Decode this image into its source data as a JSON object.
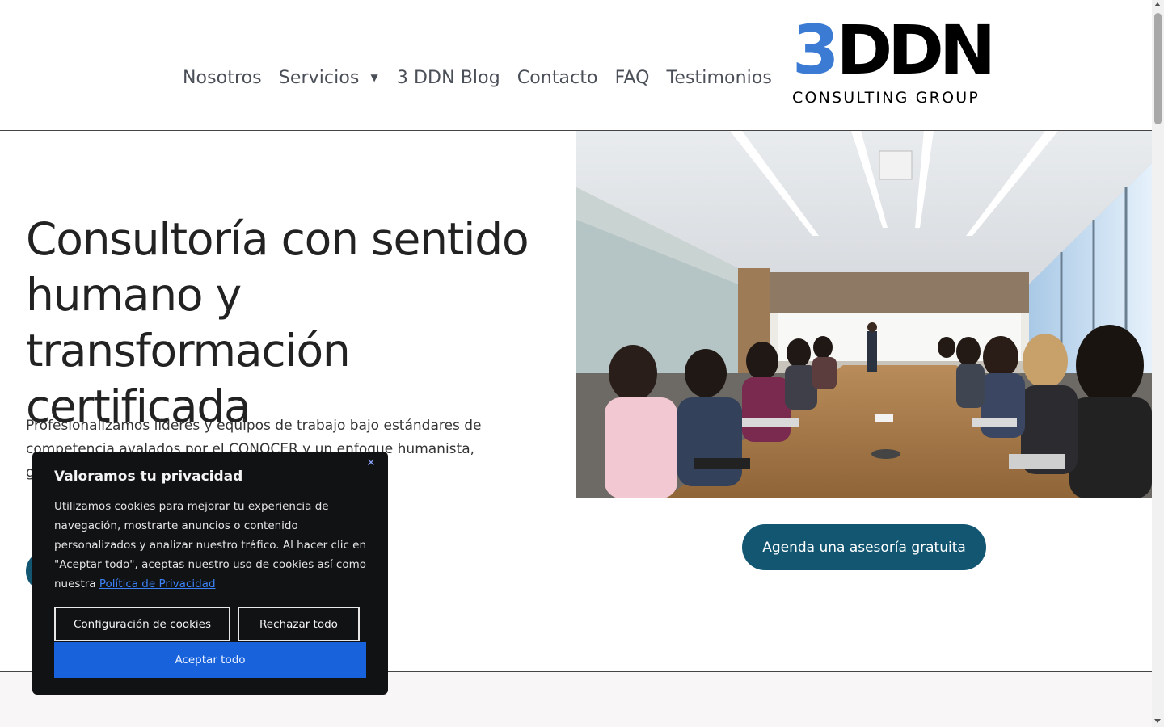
{
  "nav": {
    "items": [
      {
        "label": "Nosotros"
      },
      {
        "label": "Servicios",
        "has_dropdown": true
      },
      {
        "label": "3 DDN Blog"
      },
      {
        "label": "Contacto"
      },
      {
        "label": "FAQ"
      },
      {
        "label": "Testimonios"
      }
    ]
  },
  "logo": {
    "mark_number": "3",
    "mark_letters": "DDN",
    "subtitle": "CONSULTING GROUP",
    "accent_color": "#3b7bd4"
  },
  "hero": {
    "title": "Consultoría con sentido humano y transformación certificada",
    "text": "Profesionalizamos líderes y equipos de trabajo bajo estándares de competencia avalados por el CONOCER y un enfoque humanista, generando u",
    "cta_label": "Agenda una asesoría gratuita",
    "cta_color": "#125671"
  },
  "cookie": {
    "title": "Valoramos tu privacidad",
    "body": "Utilizamos cookies para mejorar tu experiencia de navegación, mostrarte anuncios o contenido personalizados y analizar nuestro tráfico. Al hacer clic en \"Aceptar todo\", aceptas nuestro uso de cookies así como nuestra ",
    "link_label": "Política de Privacidad",
    "settings_label": "Configuración de cookies",
    "reject_label": "Rechazar todo",
    "accept_label": "Aceptar todo",
    "close_glyph": "✕",
    "accept_color": "#1863dc"
  }
}
